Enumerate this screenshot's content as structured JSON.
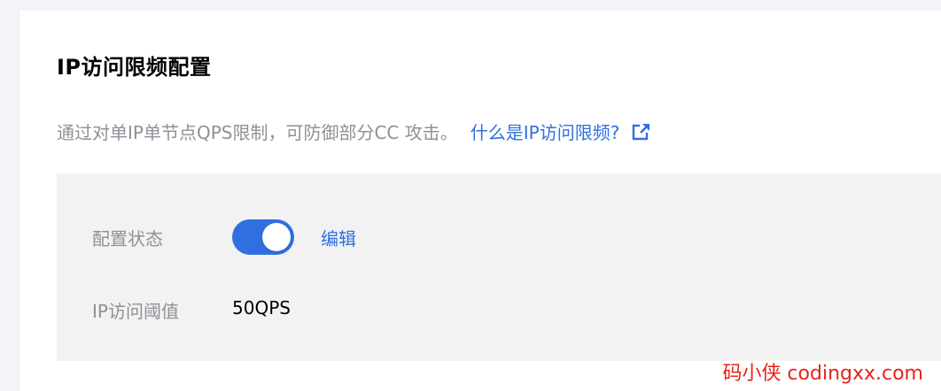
{
  "section": {
    "title": "IP访问限频配置",
    "description": "通过对单IP单节点QPS限制，可防御部分CC 攻击。",
    "help_link": "什么是IP访问限频?",
    "external_icon": "external-link-icon"
  },
  "config": {
    "status_label": "配置状态",
    "status_enabled": true,
    "edit_label": "编辑",
    "threshold_label": "IP访问阈值",
    "threshold_value": "50QPS"
  },
  "watermark": "码小侠 codingxx.com",
  "colors": {
    "accent": "#2f6fe0",
    "muted_text": "#8d9196",
    "panel_bg": "#f2f2f2",
    "watermark": "#e8231a"
  }
}
